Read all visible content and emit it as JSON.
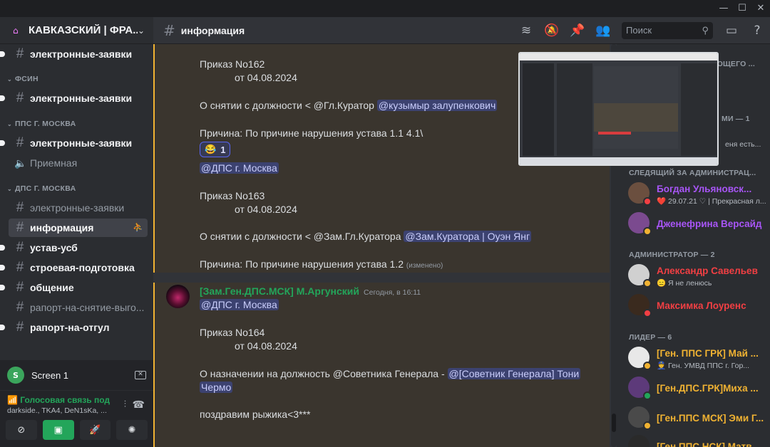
{
  "window": {
    "min": "—",
    "max": "☐",
    "close": "✕"
  },
  "sidebar": {
    "guild_name": "КАВКАЗСКИЙ | ФРА...",
    "categories": [
      "ФСИН",
      "ППС Г. МОСКВА",
      "ДПС Г. МОСКВА"
    ],
    "channels": [
      {
        "name": "электронные-заявки"
      },
      {
        "name": "электронные-заявки"
      },
      {
        "name": "электронные-заявки"
      },
      {
        "name": "Приемная"
      },
      {
        "name": "электронные-заявки"
      },
      {
        "name": "информация"
      },
      {
        "name": "устав-усб"
      },
      {
        "name": "строевая-подготовка"
      },
      {
        "name": "общение"
      },
      {
        "name": "рапорт-на-снятие-выго..."
      },
      {
        "name": "рапорт-на-отгул"
      }
    ],
    "screen_share": {
      "avatar": "S",
      "label": "Screen 1"
    },
    "voice": {
      "title": "Голосовая связь под",
      "members": "darkside., TKA4, DeN1sKa, ..."
    }
  },
  "topbar": {
    "channel": "информация",
    "search_placeholder": "Поиск"
  },
  "messages": {
    "order162": "Приказ No162",
    "date162": "от 04.08.2024",
    "line162a_pre": "О снятии с должности < @Гл.Куратор ",
    "mention162": "@кузымыр залупенкович",
    "reason162": "Причина: По причине нарушения устава 1.1  4.1\\",
    "reaction_emoji": "😂",
    "reaction_count": "1",
    "role_mention": "@ДПС г. Москва",
    "order163": "Приказ No163",
    "date163": "от 04.08.2024",
    "line163_pre": "О снятии с должности < @Зам.Гл.Куратора ",
    "mention163": "@Зам.Куратора | Оуэн Янг",
    "reason163": "Причина: По причине нарушения устава 1.2",
    "edited": "(изменено)",
    "author": "[Зам.Ген.ДПС.МСК] М.Аргунский",
    "timestamp": "Сегодня, в 16:11",
    "role_mention2": "@ДПС г. Москва",
    "order164": "Приказ No164",
    "date164": "от 04.08.2024",
    "line164_pre": "О назначении на должность @Советника Генерала - ",
    "mention164a": "@[Советник Генерала] Тони",
    "mention164b": "Чермо",
    "congrats": "поздравим рыжика<3***"
  },
  "members": {
    "cut_top": "ЮЩЕГО ...",
    "cut_cat": "МИ — 1",
    "cut_sub": "еня есть...",
    "cat_follow": "СЛЕДЯЩИЙ ЗА АДМИНИСТРАЦ...",
    "cat_admin": "АДМИНИСТРАТОР — 2",
    "cat_leader": "ЛИДЕР — 6",
    "list": [
      {
        "name": "Богдан Ульяновск...",
        "sub": "❤️ 29.07.21 ♡ | Прекрасная л...",
        "color": "#a855f7"
      },
      {
        "name": "Дженефрина Версайд",
        "sub": "",
        "color": "#a855f7"
      },
      {
        "name": "Александр Савельев",
        "sub": "😑 Я не ленюсь",
        "color": "#f23f43"
      },
      {
        "name": "Максимка Лоуренс",
        "sub": "",
        "color": "#f23f43"
      },
      {
        "name": "[Ген. ППС ГРК] Май ...",
        "sub": "👮 Ген. УМВД ППС г. Гор...",
        "color": "#f0b232"
      },
      {
        "name": "[Ген.ДПС.ГРК]Миха ...",
        "sub": "",
        "color": "#f0b232"
      },
      {
        "name": "[Ген.ППС МСК] Эми Г...",
        "sub": "",
        "color": "#f0b232"
      },
      {
        "name": "[Ген.ППС НСК] Матв...",
        "sub": "",
        "color": "#f0b232"
      }
    ]
  },
  "colors": {
    "accent": "#5865f2",
    "green": "#23a55a",
    "highlight": "#f0b232",
    "dnd": "#f23f43"
  },
  "icons": [
    "home-icon",
    "chevron-down-icon",
    "hash-icon",
    "speaker-icon",
    "add-member-icon",
    "threads-icon",
    "mute-icon",
    "pin-icon",
    "members-icon",
    "search-icon",
    "inbox-icon",
    "help-icon",
    "sound-wave-icon",
    "hangup-icon",
    "camera-off-icon",
    "screen-share-icon",
    "activity-icon",
    "soundboard-icon"
  ]
}
